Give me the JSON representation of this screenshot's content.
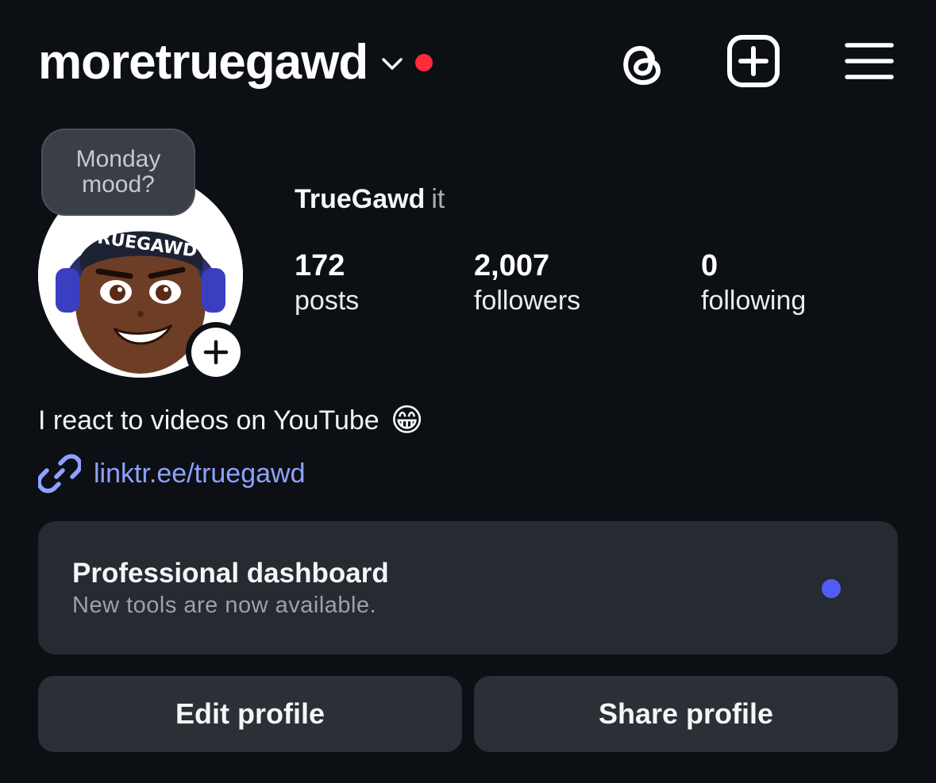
{
  "header": {
    "username": "moretruegawd",
    "icons": [
      "chevron-down-icon",
      "notification-dot",
      "threads-icon",
      "new-post-icon",
      "menu-icon"
    ],
    "notification_color": "#ff2a3a"
  },
  "profile": {
    "note": "Monday mood?",
    "avatar_text": "TRUEGAWD",
    "full_name": "TrueGawd",
    "pronouns": "it",
    "stats": [
      {
        "value": "172",
        "label": "posts"
      },
      {
        "value": "2,007",
        "label": "followers"
      },
      {
        "value": "0",
        "label": "following"
      }
    ],
    "bio": "I react to videos on YouTube",
    "bio_emoji": "😁",
    "link": "linktr.ee/truegawd"
  },
  "dashboard": {
    "title": "Professional dashboard",
    "subtitle": "New tools are now available.",
    "dot_color": "#4f5cf5"
  },
  "actions": {
    "edit_label": "Edit profile",
    "share_label": "Share profile"
  },
  "colors": {
    "background": "#0c0f14",
    "card": "#262a31",
    "link": "#8fa2ff"
  }
}
